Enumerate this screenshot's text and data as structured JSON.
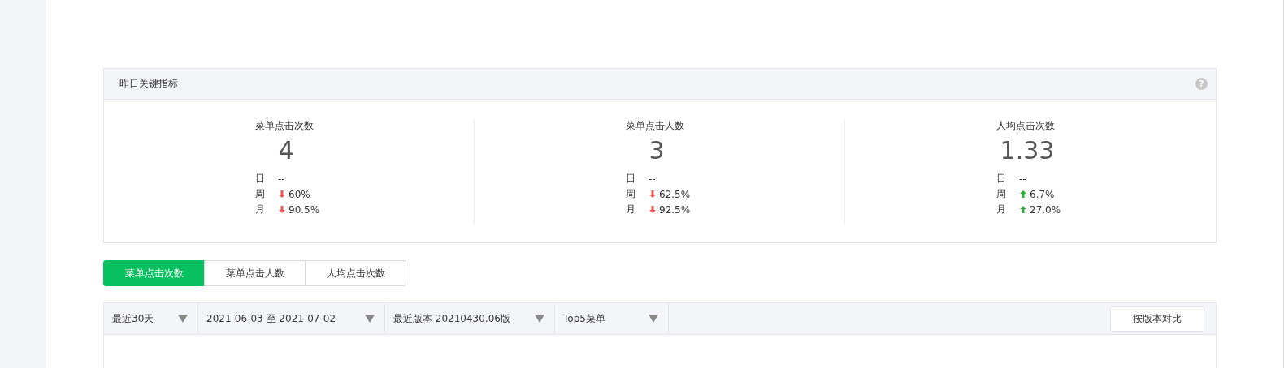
{
  "key_metrics": {
    "title": "昨日关键指标",
    "help": "?",
    "metrics": [
      {
        "label": "菜单点击次数",
        "value": "4",
        "changes": [
          {
            "period": "日",
            "kind": "flat",
            "text": "--"
          },
          {
            "period": "周",
            "kind": "down",
            "text": "60%"
          },
          {
            "period": "月",
            "kind": "down",
            "text": "90.5%"
          }
        ]
      },
      {
        "label": "菜单点击人数",
        "value": "3",
        "changes": [
          {
            "period": "日",
            "kind": "flat",
            "text": "--"
          },
          {
            "period": "周",
            "kind": "down",
            "text": "62.5%"
          },
          {
            "period": "月",
            "kind": "down",
            "text": "92.5%"
          }
        ]
      },
      {
        "label": "人均点击次数",
        "value": "1.33",
        "changes": [
          {
            "period": "日",
            "kind": "flat",
            "text": "--"
          },
          {
            "period": "周",
            "kind": "up",
            "text": "6.7%"
          },
          {
            "period": "月",
            "kind": "up",
            "text": "27.0%"
          }
        ]
      }
    ]
  },
  "tabs": [
    {
      "label": "菜单点击次数",
      "selected": true
    },
    {
      "label": "菜单点击人数",
      "selected": false
    },
    {
      "label": "人均点击次数",
      "selected": false
    }
  ],
  "filters": [
    "最近30天",
    "2021-06-03 至 2021-07-02",
    "最近版本 20210430.06版",
    "Top5菜单"
  ],
  "compare_button": "按版本对比"
}
